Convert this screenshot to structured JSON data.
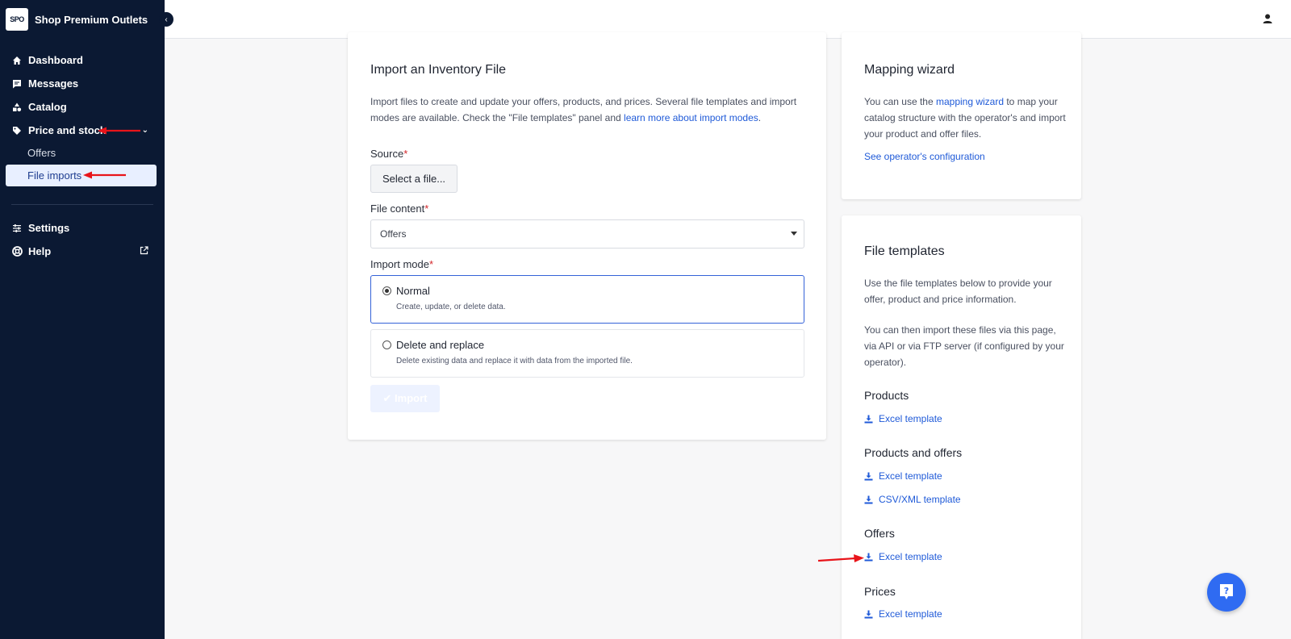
{
  "brand": {
    "logo_text": "SPO",
    "name": "Shop Premium Outlets"
  },
  "sidebar": {
    "items": [
      {
        "label": "Dashboard",
        "icon": "home-icon"
      },
      {
        "label": "Messages",
        "icon": "message-icon"
      },
      {
        "label": "Catalog",
        "icon": "shapes-icon"
      },
      {
        "label": "Price and stock",
        "icon": "tag-icon"
      }
    ],
    "sub_items": [
      {
        "label": "Offers"
      },
      {
        "label": "File imports"
      }
    ],
    "bottom_items": [
      {
        "label": "Settings",
        "icon": "sliders-icon"
      },
      {
        "label": "Help",
        "icon": "lifebuoy-icon"
      }
    ]
  },
  "import_card": {
    "title": "Import an Inventory File",
    "desc_prefix": "Import files to create and update your offers, products, and prices. Several file templates and import modes are available. Check the \"File templates\" panel and ",
    "desc_link": "learn more about import modes",
    "desc_suffix": ".",
    "source_label": "Source",
    "select_file_label": "Select a file...",
    "file_content_label": "File content",
    "file_content_value": "Offers",
    "import_mode_label": "Import mode",
    "required_mark": "*",
    "modes": [
      {
        "title": "Normal",
        "desc": "Create, update, or delete data."
      },
      {
        "title": "Delete and replace",
        "desc": "Delete existing data and replace it with data from the imported file."
      }
    ],
    "import_button": "✔ Import"
  },
  "mapping_card": {
    "title": "Mapping wizard",
    "desc_prefix": "You can use the ",
    "desc_link": "mapping wizard",
    "desc_suffix": " to map your catalog structure with the operator's and import your product and offer files.",
    "config_link": "See operator's configuration"
  },
  "templates_card": {
    "title": "File templates",
    "desc1": "Use the file templates below to provide your offer, product and price information.",
    "desc2": "You can then import these files via this page, via API or via FTP server (if configured by your operator).",
    "sections": [
      {
        "heading": "Products",
        "links": [
          "Excel template"
        ]
      },
      {
        "heading": "Products and offers",
        "links": [
          "Excel template",
          "CSV/XML template"
        ]
      },
      {
        "heading": "Offers",
        "links": [
          "Excel template"
        ]
      },
      {
        "heading": "Prices",
        "links": [
          "Excel template"
        ]
      }
    ]
  },
  "colors": {
    "sidebar_bg": "#0b1933",
    "accent": "#1f5ad8",
    "annotation_arrow": "#e8141a"
  }
}
